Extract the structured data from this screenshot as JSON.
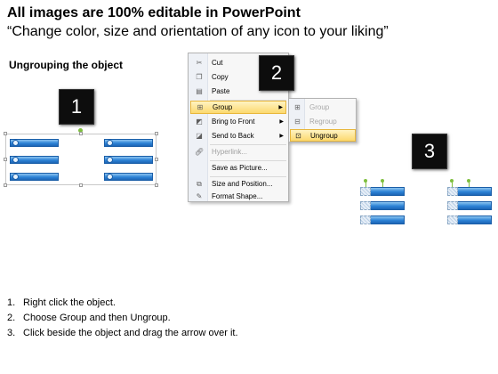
{
  "header": {
    "title": "All images are 100% editable in PowerPoint",
    "subtitle": "“Change color, size and orientation of any icon to your liking”"
  },
  "section_heading": "Ungrouping the object",
  "badges": [
    "1",
    "2",
    "3"
  ],
  "context_menu": {
    "items": [
      {
        "label": "Cut",
        "icon": "scissors-icon"
      },
      {
        "label": "Copy",
        "icon": "copy-icon"
      },
      {
        "label": "Paste",
        "icon": "paste-icon"
      },
      {
        "label": "Group",
        "icon": "group-icon",
        "submenu": true,
        "highlighted": true
      },
      {
        "label": "Bring to Front",
        "icon": "bring-to-front-icon",
        "submenu": true
      },
      {
        "label": "Send to Back",
        "icon": "send-to-back-icon",
        "submenu": true
      },
      {
        "label": "Hyperlink...",
        "icon": "hyperlink-icon",
        "disabled": true
      },
      {
        "label": "Save as Picture...",
        "icon": ""
      },
      {
        "label": "Size and Position...",
        "icon": "size-position-icon"
      },
      {
        "label": "Format Shape...",
        "icon": "format-shape-icon"
      }
    ]
  },
  "submenu": {
    "items": [
      {
        "label": "Group",
        "icon": "group-icon",
        "disabled": true
      },
      {
        "label": "Regroup",
        "icon": "regroup-icon",
        "disabled": true
      },
      {
        "label": "Ungroup",
        "icon": "ungroup-icon",
        "highlighted": true
      }
    ]
  },
  "instructions": [
    {
      "num": "1.",
      "text": "Right click the object."
    },
    {
      "num": "2.",
      "text": "Choose Group and then Ungroup."
    },
    {
      "num": "3.",
      "text": "Click beside the object and drag the arrow over it."
    }
  ],
  "colors": {
    "bar_blue": "#2c82d6",
    "menu_highlight": "#fcd96e",
    "badge_bg": "#0d0d0d"
  }
}
